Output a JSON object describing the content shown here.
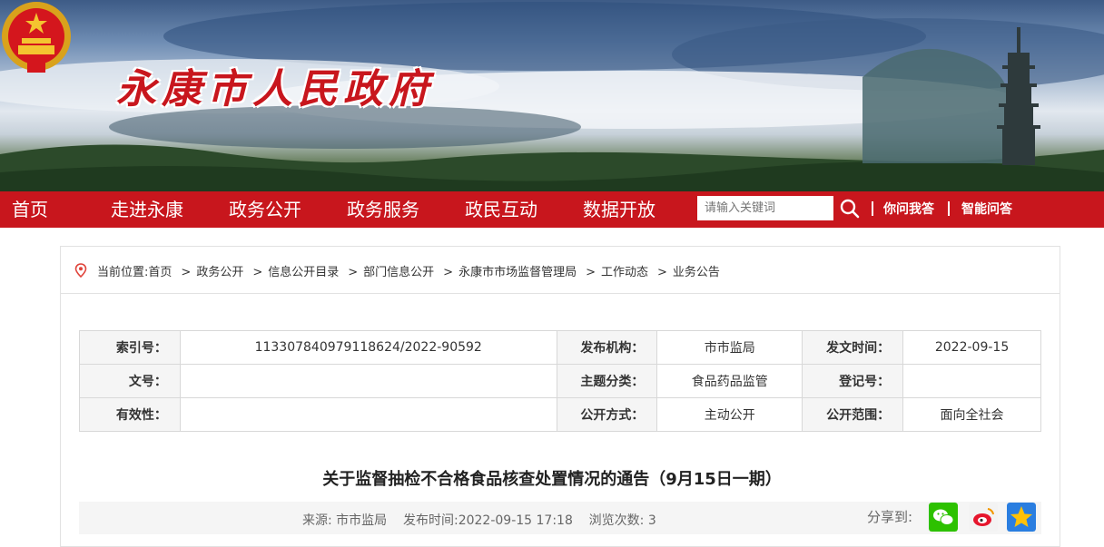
{
  "site": {
    "title": "永康市人民政府"
  },
  "nav": {
    "items": [
      "首页",
      "走进永康",
      "政务公开",
      "政务服务",
      "政民互动",
      "数据开放"
    ],
    "search_placeholder": "请输入关键词",
    "links": [
      "你问我答",
      "智能问答"
    ]
  },
  "breadcrumb": {
    "prefix": "当前位置:",
    "items": [
      "首页",
      "政务公开",
      "信息公开目录",
      "部门信息公开",
      "永康市市场监督管理局",
      "工作动态",
      "业务公告"
    ]
  },
  "meta": {
    "index_label": "索引号：",
    "index_value": "11330784097911862​4/2022-90592",
    "issuer_label": "发布机构：",
    "issuer_value": "市市监局",
    "date_label": "发文时间：",
    "date_value": "2022-09-15",
    "docno_label": "文号：",
    "docno_value": "",
    "topic_label": "主题分类：",
    "topic_value": "食品药品监管",
    "regno_label": "登记号：",
    "regno_value": "",
    "validity_label": "有效性：",
    "validity_value": "",
    "mode_label": "公开方式：",
    "mode_value": "主动公开",
    "scope_label": "公开范围：",
    "scope_value": "面向全社会"
  },
  "article": {
    "title": "关于监督抽检不合格食品核查处置情况的通告（9月15日一期）",
    "source": "来源: 市市监局",
    "published": "发布时间:2022-09-15  17:18",
    "views": "浏览次数: 3",
    "share_label": "分享到:"
  },
  "icons": [
    "emblem-icon",
    "search-icon",
    "location-pin-icon",
    "wechat-icon",
    "weibo-icon",
    "qzone-icon"
  ],
  "colors": {
    "brand_red": "#c8161d",
    "wechat_green": "#2dc100",
    "qzone_blue": "#2a7ee0"
  }
}
